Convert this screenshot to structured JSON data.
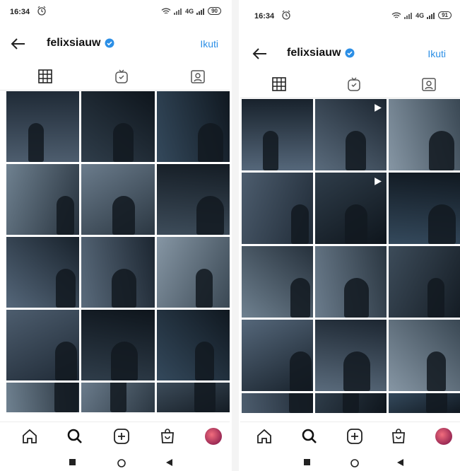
{
  "colors": {
    "accent": "#2c8fe6",
    "text": "#111111"
  },
  "screens": [
    {
      "status": {
        "time": "16:34",
        "network": "4G",
        "battery": "90"
      },
      "profile": {
        "username": "felixsiauw",
        "follow_label": "Ikuti"
      },
      "rows": 5
    },
    {
      "status": {
        "time": "16:34",
        "network": "4G",
        "battery": "91"
      },
      "profile": {
        "username": "felixsiauw",
        "follow_label": "Ikuti"
      },
      "rows": 5
    }
  ],
  "icons": {
    "back": "back-arrow-icon",
    "verified": "verified-badge-icon",
    "tabs": [
      "grid-icon",
      "igtv-icon",
      "tagged-icon"
    ],
    "bottom": [
      "home-icon",
      "search-icon",
      "create-icon",
      "shop-icon",
      "avatar"
    ],
    "system": [
      "recent-apps-icon",
      "home-button-icon",
      "back-button-icon"
    ]
  }
}
